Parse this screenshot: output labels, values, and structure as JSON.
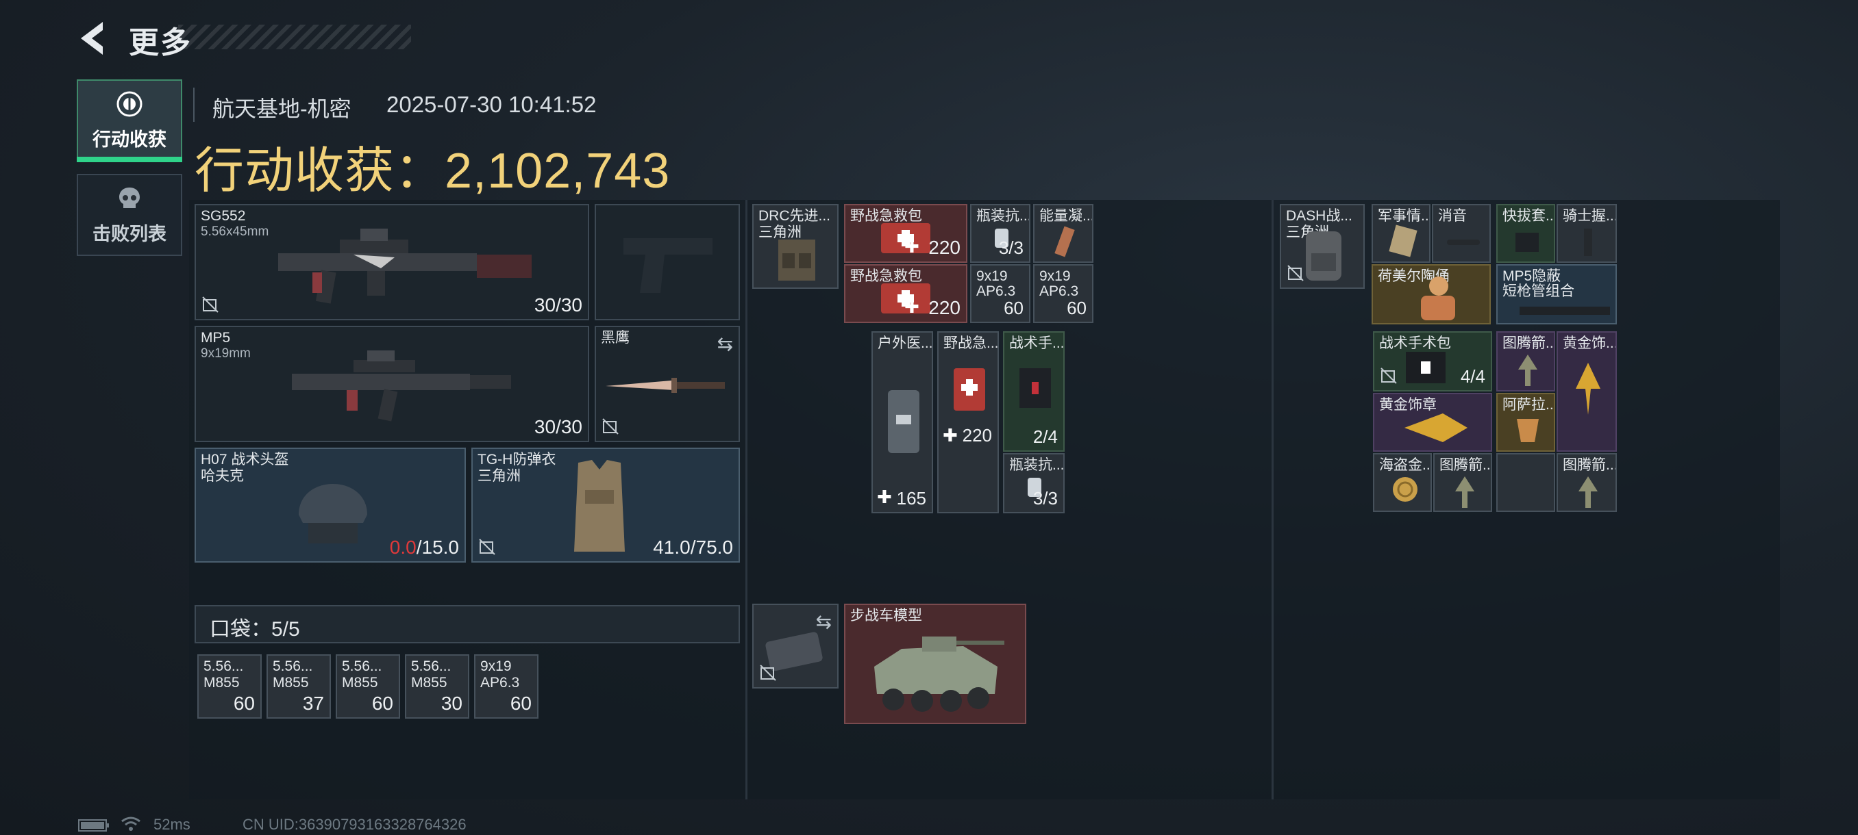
{
  "header": {
    "title": "更多"
  },
  "tabs": [
    {
      "label": "行动收获",
      "icon": "loot-icon",
      "active": true
    },
    {
      "label": "击败列表",
      "icon": "skull-icon",
      "active": false
    }
  ],
  "raid": {
    "map": "航天基地-机密",
    "datetime": "2025-07-30 10:41:52",
    "loot_label": "行动收获：",
    "loot_value": "2,102,743"
  },
  "equipment": {
    "primary1": {
      "name": "SG552",
      "caliber": "5.56x45mm",
      "ammo": "30/30"
    },
    "primary2": {
      "name": "MP5",
      "caliber": "9x19mm",
      "ammo": "30/30"
    },
    "melee": {
      "name": "黑鹰"
    },
    "helmet": {
      "name": "H07 战术头盔",
      "brand": "哈夫克",
      "dura_current": "0.0",
      "dura_max": "/15.0"
    },
    "armor": {
      "name": "TG-H防弹衣",
      "brand": "三角洲",
      "durability": "41.0/75.0"
    }
  },
  "pocket": {
    "label": "口袋：",
    "count": "5/5",
    "items": [
      {
        "l1": "5.56...",
        "l2": "M855",
        "qty": "60"
      },
      {
        "l1": "5.56...",
        "l2": "M855",
        "qty": "37"
      },
      {
        "l1": "5.56...",
        "l2": "M855",
        "qty": "60"
      },
      {
        "l1": "5.56...",
        "l2": "M855",
        "qty": "30"
      },
      {
        "l1": "9x19",
        "l2": "AP6.3",
        "qty": "60"
      }
    ]
  },
  "rig": {
    "name": "DRC先进...",
    "brand": "三角洲",
    "items": [
      {
        "name": "野战急救包",
        "qty": "220"
      },
      {
        "name": "野战急救包",
        "qty": "220"
      },
      {
        "name": "瓶装抗...",
        "qty": "3/3"
      },
      {
        "name": "能量凝...",
        "qty": ""
      },
      {
        "l1": "9x19",
        "l2": "AP6.3",
        "qty": "60"
      },
      {
        "l1": "9x19",
        "l2": "AP6.3",
        "qty": "60"
      },
      {
        "name": "户外医...",
        "qty": "165"
      },
      {
        "name": "野战急...",
        "qty": "220"
      },
      {
        "name": "战术手...",
        "qty": "2/4"
      },
      {
        "name": "瓶装抗...",
        "qty": "3/3"
      }
    ]
  },
  "case": {
    "name": "步战车模型"
  },
  "backpack": {
    "name": "DASH战...",
    "brand": "三角洲",
    "items": [
      {
        "name": "军事情..."
      },
      {
        "name": "消音"
      },
      {
        "name": "快拔套..."
      },
      {
        "name": "骑士握..."
      },
      {
        "name": "荷美尔陶俑"
      },
      {
        "name": "MP5隐蔽",
        "sub": "短枪管组合"
      },
      {
        "name": "战术手术包",
        "qty": "4/4"
      },
      {
        "name": "图腾箭..."
      },
      {
        "name": "黄金饰..."
      },
      {
        "name": "黄金饰章"
      },
      {
        "name": "阿萨拉..."
      },
      {
        "name": "海盗金..."
      },
      {
        "name": "图腾箭..."
      },
      {
        "name": "图腾箭..."
      }
    ]
  },
  "status": {
    "ping": "52ms",
    "uid": "CN UID:36390793163328764326"
  },
  "colors": {
    "loot_gold": "#f2d27a",
    "active_green": "#2fd38a",
    "durability_red": "#e0393a"
  }
}
